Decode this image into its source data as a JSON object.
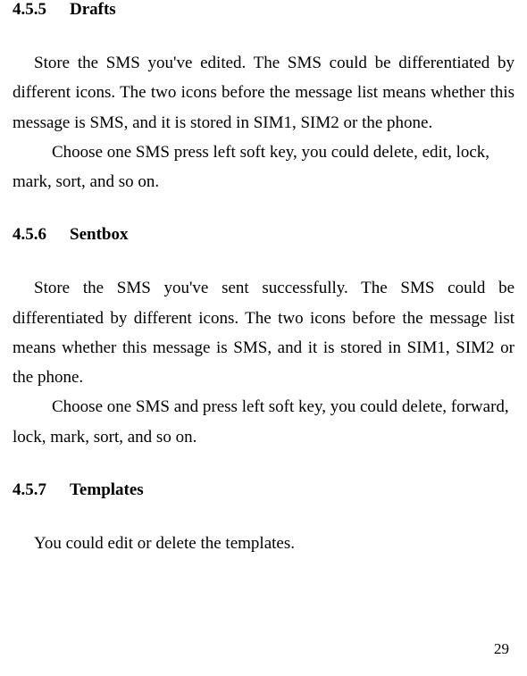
{
  "sections": [
    {
      "number": "4.5.5",
      "title": "Drafts",
      "para1": "Store the SMS you've edited. The SMS could be differentiated by different icons. The two icons before the message list means whether this message is SMS, and it is stored in SIM1, SIM2 or the phone.",
      "para2": "Choose one SMS press left soft key, you could delete, edit, lock, mark, sort, and so on."
    },
    {
      "number": "4.5.6",
      "title": "Sentbox",
      "para1": "Store the SMS you've sent successfully. The SMS could be differentiated by different icons. The two icons before the message list means whether this message is SMS, and it is stored in SIM1, SIM2 or the phone.",
      "para2": "Choose one SMS and press left soft key, you could delete, forward, lock, mark, sort, and so on."
    },
    {
      "number": "4.5.7",
      "title": "Templates",
      "para1": "You could edit or delete the templates."
    }
  ],
  "page_number": "29"
}
